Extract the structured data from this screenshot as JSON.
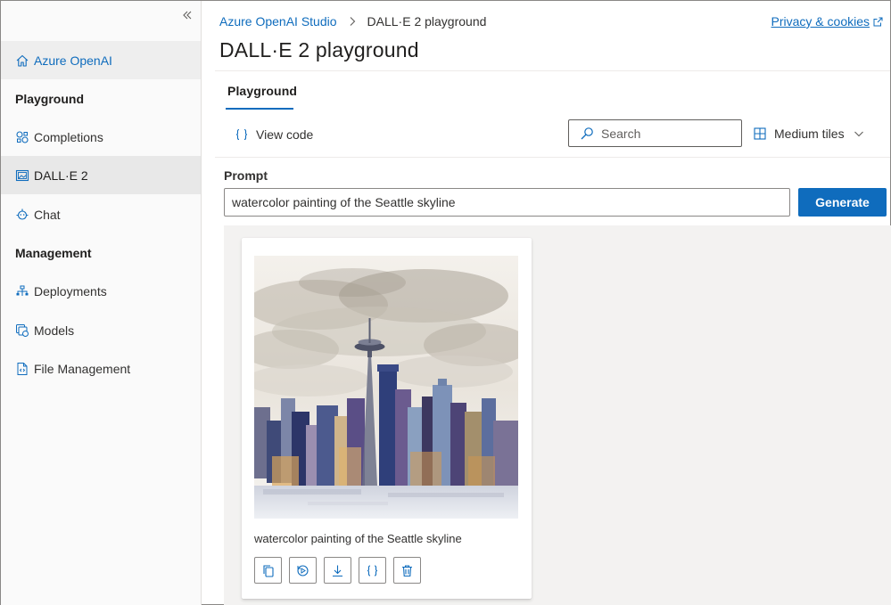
{
  "sidebar": {
    "collapse_icon": "double-chevron-left-icon",
    "items": [
      {
        "label": "Azure OpenAI",
        "icon": "home-icon"
      },
      {
        "label": "Playground",
        "type": "section"
      },
      {
        "label": "Completions",
        "icon": "completions-icon"
      },
      {
        "label": "DALL·E 2",
        "icon": "image-icon",
        "active": true
      },
      {
        "label": "Chat",
        "icon": "chat-icon"
      },
      {
        "label": "Management",
        "type": "section"
      },
      {
        "label": "Deployments",
        "icon": "deployments-icon"
      },
      {
        "label": "Models",
        "icon": "models-icon"
      },
      {
        "label": "File Management",
        "icon": "file-management-icon"
      }
    ]
  },
  "header": {
    "breadcrumb": {
      "root": "Azure OpenAI Studio",
      "current": "DALL·E 2 playground"
    },
    "privacy_link": "Privacy & cookies",
    "title": "DALL·E 2 playground"
  },
  "tabs": [
    {
      "label": "Playground",
      "active": true
    }
  ],
  "toolbar": {
    "view_code": "View code",
    "search_placeholder": "Search",
    "tile_size": "Medium tiles"
  },
  "prompt": {
    "label": "Prompt",
    "value": "watercolor painting of the Seattle skyline",
    "generate_label": "Generate"
  },
  "results": [
    {
      "caption": "watercolor painting of the Seattle skyline",
      "actions": [
        "copy-icon",
        "regenerate-icon",
        "download-icon",
        "code-icon",
        "delete-icon"
      ]
    }
  ],
  "colors": {
    "accent": "#0f6cbd",
    "sidebar_bg": "#fafafa",
    "gallery_bg": "#f3f2f1"
  }
}
